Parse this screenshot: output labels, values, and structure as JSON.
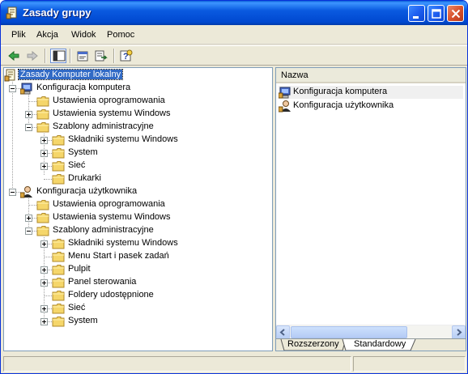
{
  "window": {
    "title": "Zasady grupy"
  },
  "menu": [
    "Plik",
    "Akcja",
    "Widok",
    "Pomoc"
  ],
  "toolbar": [
    "back-icon",
    "forward-icon",
    "show-hide-tree-icon",
    "properties-icon",
    "export-list-icon",
    "help-icon"
  ],
  "tree": [
    {
      "label": "Zasady Komputer lokalny",
      "icon": "policy-icon",
      "selected": true
    },
    {
      "label": "Konfiguracja komputera",
      "icon": "computer-icon"
    },
    {
      "label": "Ustawienia oprogramowania",
      "icon": "folder-icon"
    },
    {
      "label": "Ustawienia systemu Windows",
      "icon": "folder-icon"
    },
    {
      "label": "Szablony administracyjne",
      "icon": "folder-icon"
    },
    {
      "label": "Składniki systemu Windows",
      "icon": "folder-icon"
    },
    {
      "label": "System",
      "icon": "folder-icon"
    },
    {
      "label": "Sieć",
      "icon": "folder-icon"
    },
    {
      "label": "Drukarki",
      "icon": "folder-icon"
    },
    {
      "label": "Konfiguracja użytkownika",
      "icon": "user-icon"
    },
    {
      "label": "Ustawienia oprogramowania",
      "icon": "folder-icon"
    },
    {
      "label": "Ustawienia systemu Windows",
      "icon": "folder-icon"
    },
    {
      "label": "Szablony administracyjne",
      "icon": "folder-icon"
    },
    {
      "label": "Składniki systemu Windows",
      "icon": "folder-icon"
    },
    {
      "label": "Menu Start i pasek zadań",
      "icon": "folder-icon"
    },
    {
      "label": "Pulpit",
      "icon": "folder-icon"
    },
    {
      "label": "Panel sterowania",
      "icon": "folder-icon"
    },
    {
      "label": "Foldery udostępnione",
      "icon": "folder-icon"
    },
    {
      "label": "Sieć",
      "icon": "folder-icon"
    },
    {
      "label": "System",
      "icon": "folder-icon"
    }
  ],
  "list": {
    "column": "Nazwa",
    "items": [
      {
        "label": "Konfiguracja komputera",
        "icon": "computer-icon"
      },
      {
        "label": "Konfiguracja użytkownika",
        "icon": "user-icon"
      }
    ]
  },
  "tabs": [
    "Rozszerzony",
    "Standardowy"
  ],
  "colors": {
    "title_bar": "#0a5ae0",
    "selection": "#316ac5",
    "folder": "#f5d66a"
  }
}
